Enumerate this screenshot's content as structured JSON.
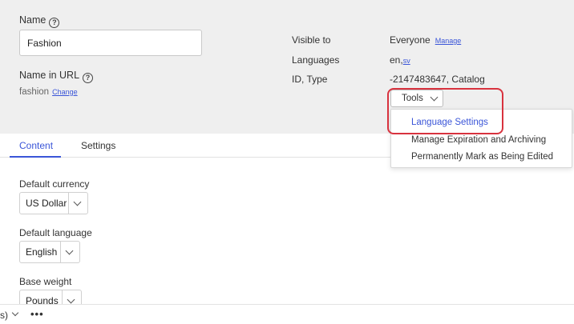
{
  "header": {
    "name_label": "Name",
    "name_value": "Fashion",
    "url_label": "Name in URL",
    "url_value": "fashion",
    "url_change": "Change"
  },
  "meta": {
    "visible_label": "Visible to",
    "visible_value": "Everyone",
    "visible_manage": "Manage",
    "languages_label": "Languages",
    "languages_value_en": "en,",
    "languages_value_sv": "sv",
    "id_label": "ID, Type",
    "id_value": "-2147483647, Catalog"
  },
  "tools": {
    "label": "Tools",
    "items": [
      "Language Settings",
      "Manage Expiration and Archiving",
      "Permanently Mark as Being Edited"
    ],
    "highlight_color": "#d8323e"
  },
  "tabs": [
    "Content",
    "Settings"
  ],
  "content": {
    "currency_label": "Default currency",
    "currency_value": "US Dollar",
    "language_label": "Default language",
    "language_value": "English",
    "weight_label": "Base weight",
    "weight_value": "Pounds"
  },
  "bottom": {
    "partial_text": "s)",
    "more": "•••"
  },
  "colors": {
    "accent": "#3a55d8",
    "panel_bg": "#efefef"
  }
}
